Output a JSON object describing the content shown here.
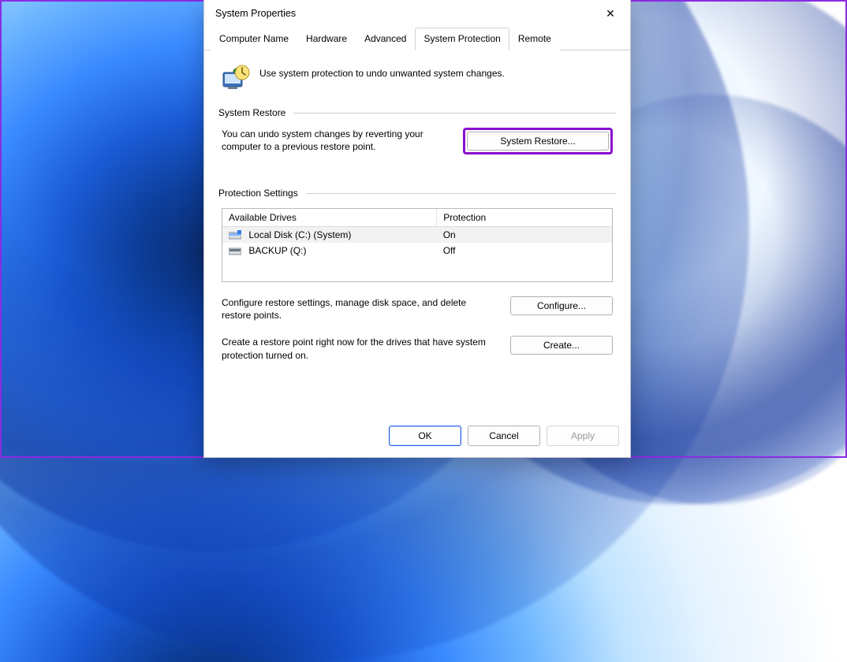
{
  "window": {
    "title": "System Properties",
    "close_glyph": "✕"
  },
  "tabs": [
    {
      "label": "Computer Name",
      "active": false
    },
    {
      "label": "Hardware",
      "active": false
    },
    {
      "label": "Advanced",
      "active": false
    },
    {
      "label": "System Protection",
      "active": true
    },
    {
      "label": "Remote",
      "active": false
    }
  ],
  "intro_text": "Use system protection to undo unwanted system changes.",
  "groups": {
    "restore": {
      "title": "System Restore",
      "desc": "You can undo system changes by reverting your computer to a previous restore point.",
      "button": "System Restore..."
    },
    "protection": {
      "title": "Protection Settings",
      "columns": {
        "drive": "Available Drives",
        "protection": "Protection"
      },
      "rows": [
        {
          "name": "Local Disk (C:) (System)",
          "protection": "On",
          "selected": true,
          "icon": "drive-c-icon"
        },
        {
          "name": "BACKUP (Q:)",
          "protection": "Off",
          "selected": false,
          "icon": "drive-q-icon"
        }
      ],
      "configure_desc": "Configure restore settings, manage disk space, and delete restore points.",
      "configure_button": "Configure...",
      "create_desc": "Create a restore point right now for the drives that have system protection turned on.",
      "create_button": "Create..."
    }
  },
  "footer": {
    "ok": "OK",
    "cancel": "Cancel",
    "apply": "Apply"
  },
  "colors": {
    "highlight_border": "#8a10cf",
    "primary_border": "#2563eb"
  }
}
